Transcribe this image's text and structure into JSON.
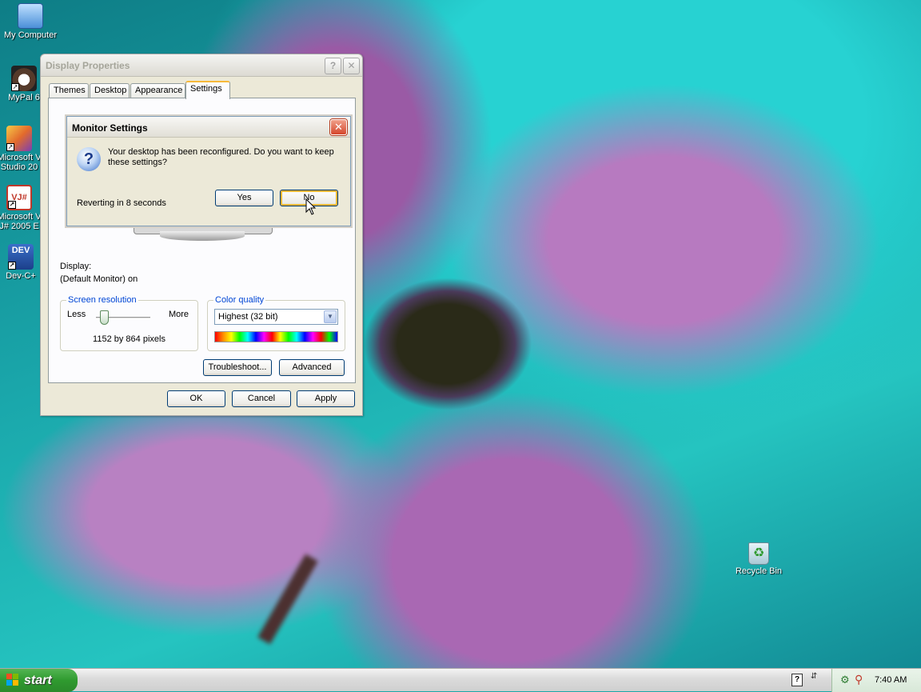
{
  "desktop": {
    "icons": [
      {
        "label": "My Computer"
      },
      {
        "label": "MyPal 6"
      },
      {
        "label": "Microsoft V Studio 20"
      },
      {
        "label": "Microsoft V J# 2005 E"
      },
      {
        "label": "Dev-C+"
      },
      {
        "label": "Recycle Bin"
      }
    ]
  },
  "window": {
    "title": "Display Properties",
    "help_glyph": "?",
    "close_glyph": "✕",
    "tabs": [
      "Themes",
      "Desktop",
      "Appearance",
      "Settings"
    ],
    "active_tab": "Settings",
    "display_label": "Display:",
    "display_value": "(Default Monitor) on",
    "screen_resolution": {
      "label": "Screen resolution",
      "less": "Less",
      "more": "More",
      "value_text": "1152 by 864 pixels",
      "slider_fraction": 0.15
    },
    "color_quality": {
      "label": "Color quality",
      "selected": "Highest (32 bit)"
    },
    "troubleshoot_label": "Troubleshoot...",
    "advanced_label": "Advanced",
    "ok_label": "OK",
    "cancel_label": "Cancel",
    "apply_label": "Apply"
  },
  "dialog": {
    "title": "Monitor Settings",
    "close_glyph": "✕",
    "message_line1": "Your desktop has been reconfigured.  Do you want to keep",
    "message_line2": "these settings?",
    "countdown": "Reverting in 8 seconds",
    "yes_label": "Yes",
    "no_label": "No"
  },
  "taskbar": {
    "start_label": "start",
    "clock": "7:40 AM"
  },
  "colors": {
    "accent": "#0046d5",
    "start_green": "#2f9a2f",
    "focus_orange": "#f8b836"
  }
}
